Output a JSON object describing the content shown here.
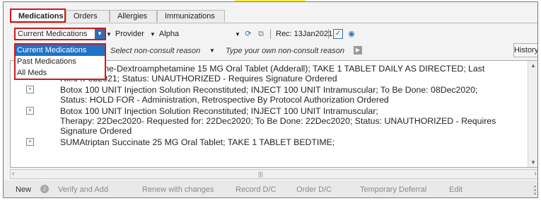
{
  "tabs": [
    {
      "label": "Medications",
      "active": true
    },
    {
      "label": "Orders",
      "active": false
    },
    {
      "label": "Allergies",
      "active": false
    },
    {
      "label": "Immunizations",
      "active": false
    }
  ],
  "toolbar": {
    "filter_value": "Current Medications",
    "provider_label": "Provider",
    "alpha_label": "Alpha",
    "refresh_icon": "refresh-icon",
    "copy_icon": "copy-icon",
    "rec_label": "Rec: 13Jan2021",
    "check_icon": "check-icon",
    "circle_icon": "list-circle-icon"
  },
  "dropdown": {
    "options": [
      "Current Medications",
      "Past Medications",
      "All Meds"
    ],
    "selected": "Current Medications"
  },
  "reason": {
    "select_placeholder": "Select non-consult reason",
    "type_placeholder": "Type your own non-consult reason",
    "history_label": "History"
  },
  "medications": [
    {
      "lines": [
        "Amphetamine-Dextroamphetamine 15 MG Oral Tablet (Adderall); TAKE 1 TABLET DAILY AS DIRECTED; Last",
        "Rx:04Feb2021; Status: UNAUTHORIZED - Requires Signature Ordered"
      ]
    },
    {
      "lines": [
        "Botox 100 UNIT Injection Solution Reconstituted; INJECT 100  UNIT Intramuscular; To Be Done: 08Dec2020;",
        "Status: HOLD FOR - Administration, Retrospective By Protocol Authorization Ordered"
      ]
    },
    {
      "lines": [
        "Botox 100 UNIT Injection Solution Reconstituted; INJECT 100  UNIT Intramuscular;",
        "Therapy: 22Dec2020-  Requested for: 22Dec2020; To Be Done: 22Dec2020; Status: UNAUTHORIZED - Requires",
        "Signature Ordered"
      ]
    },
    {
      "lines": [
        "SUMAtriptan Succinate 25 MG Oral Tablet; TAKE 1 TABLET BEDTIME;"
      ]
    }
  ],
  "bottom_actions": {
    "new": "New",
    "verify_add": "Verify and Add",
    "renew": "Renew with changes",
    "record_dc": "Record D/C",
    "order_dc": "Order D/C",
    "temporary_deferral": "Temporary Deferral",
    "edit": "Edit"
  },
  "colors": {
    "highlight_red": "#d2181a",
    "selection_blue": "#1e73c8",
    "banner_yellow": "#f5ea3c"
  }
}
